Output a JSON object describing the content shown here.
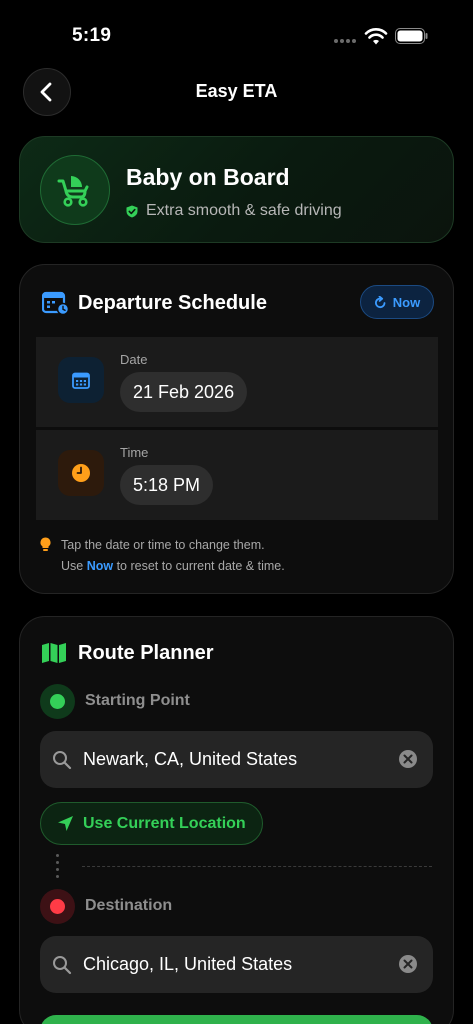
{
  "status_bar": {
    "time": "5:19",
    "icons": [
      "signal-dots-icon",
      "wifi-icon",
      "battery-icon"
    ]
  },
  "nav": {
    "title": "Easy ETA",
    "back_icon": "chevron-left-icon"
  },
  "baby_card": {
    "icon": "stroller-icon",
    "title": "Baby on Board",
    "subtitle": "Extra smooth & safe driving",
    "subtitle_icon": "shield-check-icon"
  },
  "schedule": {
    "icon": "calendar-clock-icon",
    "title": "Departure Schedule",
    "now_button": "Now",
    "date": {
      "label": "Date",
      "value": "21 Feb 2026",
      "icon": "calendar-icon"
    },
    "time": {
      "label": "Time",
      "value": "5:18 PM",
      "icon": "clock-icon"
    },
    "hint_line1": "Tap the date or time to change them.",
    "hint_line2_prefix": "Use ",
    "hint_line2_link": "Now",
    "hint_line2_suffix": " to reset to current date & time.",
    "hint_icon": "lightbulb-icon"
  },
  "route": {
    "icon": "map-icon",
    "title": "Route Planner",
    "start": {
      "label": "Starting Point",
      "value": "Newark, CA, United States"
    },
    "use_current_location": "Use Current Location",
    "destination": {
      "label": "Destination",
      "value": "Chicago, IL, United States"
    }
  },
  "colors": {
    "background": "#000000",
    "accent_green": "#34d058",
    "accent_blue": "#3b9bff",
    "accent_red": "#ff3b46",
    "accent_orange": "#ff9f1a"
  }
}
